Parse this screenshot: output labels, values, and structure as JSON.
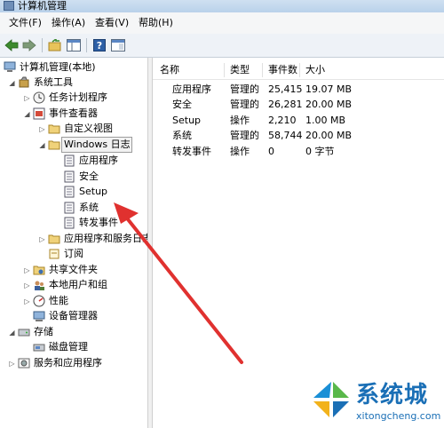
{
  "window": {
    "title": "计算机管理"
  },
  "menu": [
    {
      "id": "file",
      "label": "文件(F)"
    },
    {
      "id": "action",
      "label": "操作(A)"
    },
    {
      "id": "view",
      "label": "查看(V)"
    },
    {
      "id": "help",
      "label": "帮助(H)"
    }
  ],
  "toolbar": [
    "back-icon",
    "forward-icon",
    "up-folder-icon",
    "show-hide-tree-icon",
    "help-icon",
    "properties-icon"
  ],
  "tree": [
    {
      "label": "计算机管理(本地)",
      "icon": "computer-icon"
    },
    {
      "label": "系统工具",
      "icon": "tools-icon"
    },
    {
      "label": "任务计划程序",
      "icon": "clock-icon"
    },
    {
      "label": "事件查看器",
      "icon": "event-viewer-icon"
    },
    {
      "label": "自定义视图",
      "icon": "folder-icon"
    },
    {
      "label": "Windows 日志",
      "icon": "folder-icon"
    },
    {
      "label": "应用程序",
      "icon": "log-icon"
    },
    {
      "label": "安全",
      "icon": "log-icon"
    },
    {
      "label": "Setup",
      "icon": "log-icon"
    },
    {
      "label": "系统",
      "icon": "log-icon"
    },
    {
      "label": "转发事件",
      "icon": "log-icon"
    },
    {
      "label": "应用程序和服务日志",
      "icon": "folder-icon"
    },
    {
      "label": "订阅",
      "icon": "subscription-icon"
    },
    {
      "label": "共享文件夹",
      "icon": "shared-folder-icon"
    },
    {
      "label": "本地用户和组",
      "icon": "users-icon"
    },
    {
      "label": "性能",
      "icon": "performance-icon"
    },
    {
      "label": "设备管理器",
      "icon": "device-manager-icon"
    },
    {
      "label": "存储",
      "icon": "storage-icon"
    },
    {
      "label": "磁盘管理",
      "icon": "disk-icon"
    },
    {
      "label": "服务和应用程序",
      "icon": "services-icon"
    }
  ],
  "list": {
    "columns": [
      "名称",
      "类型",
      "事件数",
      "大小"
    ],
    "rows": [
      [
        "应用程序",
        "管理的",
        "25,415",
        "19.07 MB"
      ],
      [
        "安全",
        "管理的",
        "26,281",
        "20.00 MB"
      ],
      [
        "Setup",
        "操作",
        "2,210",
        "1.00 MB"
      ],
      [
        "系统",
        "管理的",
        "58,744",
        "20.00 MB"
      ],
      [
        "转发事件",
        "操作",
        "0",
        "0 字节"
      ]
    ]
  },
  "annotation": {
    "color": "#e0312f"
  },
  "watermark": {
    "text": "系统城",
    "url": "xitongcheng.com"
  }
}
